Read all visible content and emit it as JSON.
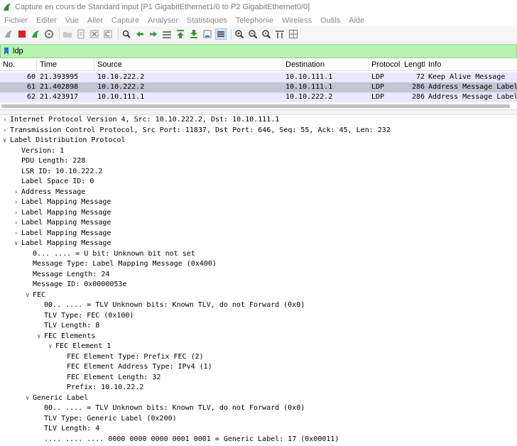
{
  "window": {
    "title": "Capture en cours de Standard input [P1 GigabitEthernet1/0 to P2 GigabitEthernet0/0]"
  },
  "menu": [
    "Fichier",
    "Editer",
    "Vue",
    "Aller",
    "Capture",
    "Analyser",
    "Statistiques",
    "Telephonie",
    "Wireless",
    "Outils",
    "Aide"
  ],
  "filter": {
    "value": "ldp"
  },
  "packet_list": {
    "columns": [
      "No.",
      "Time",
      "Source",
      "Destination",
      "Protocol",
      "Length",
      "Info"
    ],
    "rows": [
      {
        "no": "60",
        "time": "21.393995",
        "source": "10.10.222.2",
        "destination": "10.10.111.1",
        "protocol": "LDP",
        "length": "72",
        "info": "Keep Alive Message"
      },
      {
        "no": "61",
        "time": "21.402898",
        "source": "10.10.222.2",
        "destination": "10.10.111.1",
        "protocol": "LDP",
        "length": "286",
        "info": "Address Message Label"
      },
      {
        "no": "62",
        "time": "21.423917",
        "source": "10.10.111.1",
        "destination": "10.10.222.2",
        "protocol": "LDP",
        "length": "286",
        "info": "Address Message Label"
      }
    ]
  },
  "details": [
    {
      "indent": 0,
      "arrow": "collapsed",
      "text": "Internet Protocol Version 4, Src: 10.10.222.2, Dst: 10.10.111.1"
    },
    {
      "indent": 0,
      "arrow": "collapsed",
      "text": "Transmission Control Protocol, Src Port: 11837, Dst Port: 646, Seq: 55, Ack: 45, Len: 232"
    },
    {
      "indent": 0,
      "arrow": "expanded",
      "text": "Label Distribution Protocol"
    },
    {
      "indent": 1,
      "arrow": "none",
      "text": "Version: 1"
    },
    {
      "indent": 1,
      "arrow": "none",
      "text": "PDU Length: 228"
    },
    {
      "indent": 1,
      "arrow": "none",
      "text": "LSR ID: 10.10.222.2"
    },
    {
      "indent": 1,
      "arrow": "none",
      "text": "Label Space ID: 0"
    },
    {
      "indent": 1,
      "arrow": "collapsed",
      "text": "Address Message"
    },
    {
      "indent": 1,
      "arrow": "collapsed",
      "text": "Label Mapping Message"
    },
    {
      "indent": 1,
      "arrow": "collapsed",
      "text": "Label Mapping Message"
    },
    {
      "indent": 1,
      "arrow": "collapsed",
      "text": "Label Mapping Message"
    },
    {
      "indent": 1,
      "arrow": "collapsed",
      "text": "Label Mapping Message"
    },
    {
      "indent": 1,
      "arrow": "expanded",
      "text": "Label Mapping Message"
    },
    {
      "indent": 2,
      "arrow": "none",
      "text": "0... .... = U bit: Unknown bit not set"
    },
    {
      "indent": 2,
      "arrow": "none",
      "text": "Message Type: Label Mapping Message (0x400)"
    },
    {
      "indent": 2,
      "arrow": "none",
      "text": "Message Length: 24"
    },
    {
      "indent": 2,
      "arrow": "none",
      "text": "Message ID: 0x0000053e"
    },
    {
      "indent": 2,
      "arrow": "expanded",
      "text": "FEC"
    },
    {
      "indent": 3,
      "arrow": "none",
      "text": "00.. .... = TLV Unknown bits: Known TLV, do not Forward (0x0)"
    },
    {
      "indent": 3,
      "arrow": "none",
      "text": "TLV Type: FEC (0x100)"
    },
    {
      "indent": 3,
      "arrow": "none",
      "text": "TLV Length: 8"
    },
    {
      "indent": 3,
      "arrow": "expanded",
      "text": "FEC Elements"
    },
    {
      "indent": 4,
      "arrow": "expanded",
      "text": "FEC Element 1"
    },
    {
      "indent": 5,
      "arrow": "none",
      "text": "FEC Element Type: Prefix FEC (2)"
    },
    {
      "indent": 5,
      "arrow": "none",
      "text": "FEC Element Address Type: IPv4 (1)"
    },
    {
      "indent": 5,
      "arrow": "none",
      "text": "FEC Element Length: 32"
    },
    {
      "indent": 5,
      "arrow": "none",
      "text": "Prefix: 10.10.22.2"
    },
    {
      "indent": 2,
      "arrow": "expanded",
      "text": "Generic Label"
    },
    {
      "indent": 3,
      "arrow": "none",
      "text": "00.. .... = TLV Unknown bits: Known TLV, do not Forward (0x0)"
    },
    {
      "indent": 3,
      "arrow": "none",
      "text": "TLV Type: Generic Label (0x200)"
    },
    {
      "indent": 3,
      "arrow": "none",
      "text": "TLV Length: 4"
    },
    {
      "indent": 3,
      "arrow": "none",
      "text": ".... .... .... 0000 0000 0000 0001 0001 = Generic Label: 17 (0x00011)"
    }
  ],
  "colors": {
    "filter_bg": "#b6f2b0",
    "row_even": "#e8e8fe",
    "row_selected": "#c4c4d2",
    "row_odd": "#e8e8fe"
  }
}
